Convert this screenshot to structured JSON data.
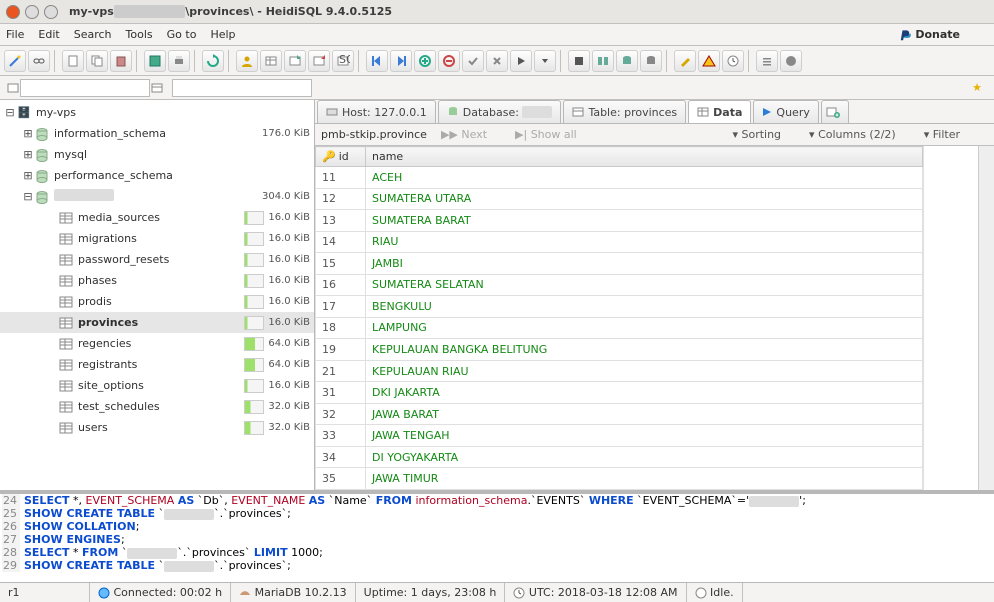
{
  "window": {
    "title_prefix": "my-vps",
    "title_suffix": "\\provinces\\ - HeidiSQL 9.4.0.5125"
  },
  "menu": [
    "File",
    "Edit",
    "Search",
    "Tools",
    "Go to",
    "Help"
  ],
  "donate_label": "Donate",
  "tabs": {
    "host": "Host: 127.0.0.1",
    "database": "Database:",
    "table": "Table: provinces",
    "data": "Data",
    "query": "Query"
  },
  "gridbar": {
    "crumb": "pmb-stkip.province",
    "next": "Next",
    "showall": "Show all",
    "sorting": "Sorting",
    "columns": "Columns (2/2)",
    "filter": "Filter"
  },
  "tree": {
    "server": "my-vps",
    "databases": [
      {
        "name": "information_schema",
        "size": "176.0 KiB"
      },
      {
        "name": "mysql",
        "size": ""
      },
      {
        "name": "performance_schema",
        "size": ""
      }
    ],
    "currentdb_size": "304.0 KiB",
    "tables": [
      {
        "name": "media_sources",
        "size": "16.0 KiB",
        "pct": 15
      },
      {
        "name": "migrations",
        "size": "16.0 KiB",
        "pct": 15
      },
      {
        "name": "password_resets",
        "size": "16.0 KiB",
        "pct": 15
      },
      {
        "name": "phases",
        "size": "16.0 KiB",
        "pct": 15
      },
      {
        "name": "prodis",
        "size": "16.0 KiB",
        "pct": 15
      },
      {
        "name": "provinces",
        "size": "16.0 KiB",
        "pct": 15,
        "selected": true
      },
      {
        "name": "regencies",
        "size": "64.0 KiB",
        "pct": 55
      },
      {
        "name": "registrants",
        "size": "64.0 KiB",
        "pct": 55
      },
      {
        "name": "site_options",
        "size": "16.0 KiB",
        "pct": 15
      },
      {
        "name": "test_schedules",
        "size": "32.0 KiB",
        "pct": 30
      },
      {
        "name": "users",
        "size": "32.0 KiB",
        "pct": 30
      }
    ]
  },
  "columns": [
    "id",
    "name"
  ],
  "rows": [
    {
      "id": "11",
      "name": "ACEH"
    },
    {
      "id": "12",
      "name": "SUMATERA UTARA"
    },
    {
      "id": "13",
      "name": "SUMATERA BARAT"
    },
    {
      "id": "14",
      "name": "RIAU"
    },
    {
      "id": "15",
      "name": "JAMBI"
    },
    {
      "id": "16",
      "name": "SUMATERA SELATAN"
    },
    {
      "id": "17",
      "name": "BENGKULU"
    },
    {
      "id": "18",
      "name": "LAMPUNG"
    },
    {
      "id": "19",
      "name": "KEPULAUAN BANGKA BELITUNG"
    },
    {
      "id": "21",
      "name": "KEPULAUAN RIAU"
    },
    {
      "id": "31",
      "name": "DKI JAKARTA"
    },
    {
      "id": "32",
      "name": "JAWA BARAT"
    },
    {
      "id": "33",
      "name": "JAWA TENGAH"
    },
    {
      "id": "34",
      "name": "DI YOGYAKARTA"
    },
    {
      "id": "35",
      "name": "JAWA TIMUR"
    }
  ],
  "sql_lines": [
    {
      "n": "24",
      "html": "<span class='kw'>SELECT</span> *, <span class='id2'>EVENT_SCHEMA</span> <span class='kw'>AS</span> `Db`, <span class='id2'>EVENT_NAME</span> <span class='kw'>AS</span> `Name` <span class='kw'>FROM</span> <span class='id2'>information_schema</span>.`EVENTS` <span class='kw'>WHERE</span> `EVENT_SCHEMA`='<span class='redact'></span>';"
    },
    {
      "n": "25",
      "html": "<span class='kw'>SHOW CREATE TABLE</span> `<span class='redact'></span>`.`provinces`;"
    },
    {
      "n": "26",
      "html": "<span class='kw'>SHOW COLLATION</span>;"
    },
    {
      "n": "27",
      "html": "<span class='kw'>SHOW ENGINES</span>;"
    },
    {
      "n": "28",
      "html": "<span class='kw'>SELECT</span> * <span class='kw'>FROM</span> `<span class='redact'></span>`.`provinces` <span class='kw'>LIMIT</span> 1000;"
    },
    {
      "n": "29",
      "html": "<span class='kw'>SHOW CREATE TABLE</span> `<span class='redact'></span>`.`provinces`;"
    }
  ],
  "status": {
    "r": "1",
    "connected": "Connected: 00:02 h",
    "server": "MariaDB 10.2.13",
    "uptime": "Uptime: 1 days, 23:08 h",
    "utc": "UTC: 2018-03-18 12:08 AM",
    "idle": "Idle."
  }
}
